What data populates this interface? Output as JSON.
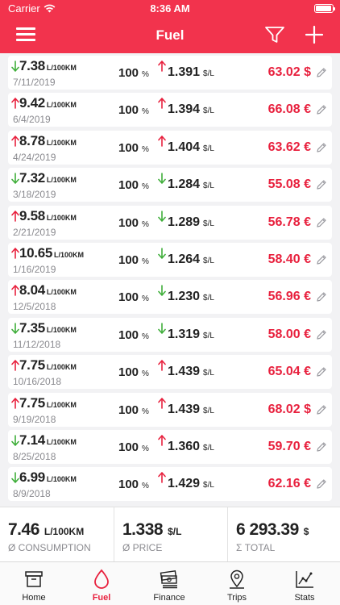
{
  "status_bar": {
    "carrier": "Carrier",
    "time": "8:36 AM"
  },
  "nav": {
    "title": "Fuel"
  },
  "fill_ups": [
    {
      "trend": "down",
      "consumption": "7.38",
      "unit": "L/100KM",
      "date": "7/11/2019",
      "fill_percent": "100",
      "percent_unit": "%",
      "price_trend": "up",
      "price": "1.391",
      "price_unit": "$/L",
      "total": "63.02 $"
    },
    {
      "trend": "up",
      "consumption": "9.42",
      "unit": "L/100KM",
      "date": "6/4/2019",
      "fill_percent": "100",
      "percent_unit": "%",
      "price_trend": "up",
      "price": "1.394",
      "price_unit": "$/L",
      "total": "66.08 €"
    },
    {
      "trend": "up",
      "consumption": "8.78",
      "unit": "L/100KM",
      "date": "4/24/2019",
      "fill_percent": "100",
      "percent_unit": "%",
      "price_trend": "up",
      "price": "1.404",
      "price_unit": "$/L",
      "total": "63.62 €"
    },
    {
      "trend": "down",
      "consumption": "7.32",
      "unit": "L/100KM",
      "date": "3/18/2019",
      "fill_percent": "100",
      "percent_unit": "%",
      "price_trend": "down",
      "price": "1.284",
      "price_unit": "$/L",
      "total": "55.08 €"
    },
    {
      "trend": "up",
      "consumption": "9.58",
      "unit": "L/100KM",
      "date": "2/21/2019",
      "fill_percent": "100",
      "percent_unit": "%",
      "price_trend": "down",
      "price": "1.289",
      "price_unit": "$/L",
      "total": "56.78 €"
    },
    {
      "trend": "up",
      "consumption": "10.65",
      "unit": "L/100KM",
      "date": "1/16/2019",
      "fill_percent": "100",
      "percent_unit": "%",
      "price_trend": "down",
      "price": "1.264",
      "price_unit": "$/L",
      "total": "58.40 €"
    },
    {
      "trend": "up",
      "consumption": "8.04",
      "unit": "L/100KM",
      "date": "12/5/2018",
      "fill_percent": "100",
      "percent_unit": "%",
      "price_trend": "down",
      "price": "1.230",
      "price_unit": "$/L",
      "total": "56.96 €"
    },
    {
      "trend": "down",
      "consumption": "7.35",
      "unit": "L/100KM",
      "date": "11/12/2018",
      "fill_percent": "100",
      "percent_unit": "%",
      "price_trend": "down",
      "price": "1.319",
      "price_unit": "$/L",
      "total": "58.00 €"
    },
    {
      "trend": "up",
      "consumption": "7.75",
      "unit": "L/100KM",
      "date": "10/16/2018",
      "fill_percent": "100",
      "percent_unit": "%",
      "price_trend": "up",
      "price": "1.439",
      "price_unit": "$/L",
      "total": "65.04 €"
    },
    {
      "trend": "up",
      "consumption": "7.75",
      "unit": "L/100KM",
      "date": "9/19/2018",
      "fill_percent": "100",
      "percent_unit": "%",
      "price_trend": "up",
      "price": "1.439",
      "price_unit": "$/L",
      "total": "68.02 $"
    },
    {
      "trend": "down",
      "consumption": "7.14",
      "unit": "L/100KM",
      "date": "8/25/2018",
      "fill_percent": "100",
      "percent_unit": "%",
      "price_trend": "up",
      "price": "1.360",
      "price_unit": "$/L",
      "total": "59.70 €"
    },
    {
      "trend": "down",
      "consumption": "6.99",
      "unit": "L/100KM",
      "date": "8/9/2018",
      "fill_percent": "100",
      "percent_unit": "%",
      "price_trend": "up",
      "price": "1.429",
      "price_unit": "$/L",
      "total": "62.16 €"
    }
  ],
  "summary": {
    "consumption": {
      "value": "7.46",
      "unit": "L/100KM",
      "label": "Ø CONSUMPTION"
    },
    "price": {
      "value": "1.338",
      "unit": "$/L",
      "label": "Ø PRICE"
    },
    "total": {
      "value": "6 293.39",
      "unit": "$",
      "label": "Σ TOTAL"
    }
  },
  "tabs": [
    {
      "label": "Home",
      "icon": "home-box-icon",
      "active": false
    },
    {
      "label": "Fuel",
      "icon": "fuel-drop-icon",
      "active": true
    },
    {
      "label": "Finance",
      "icon": "money-stack-icon",
      "active": false
    },
    {
      "label": "Trips",
      "icon": "map-pin-icon",
      "active": false
    },
    {
      "label": "Stats",
      "icon": "line-chart-icon",
      "active": false
    }
  ],
  "colors": {
    "brand": "#f2334d",
    "total_red": "#e8213e",
    "trend_up": "#e8213e",
    "trend_down": "#3fae3a"
  }
}
